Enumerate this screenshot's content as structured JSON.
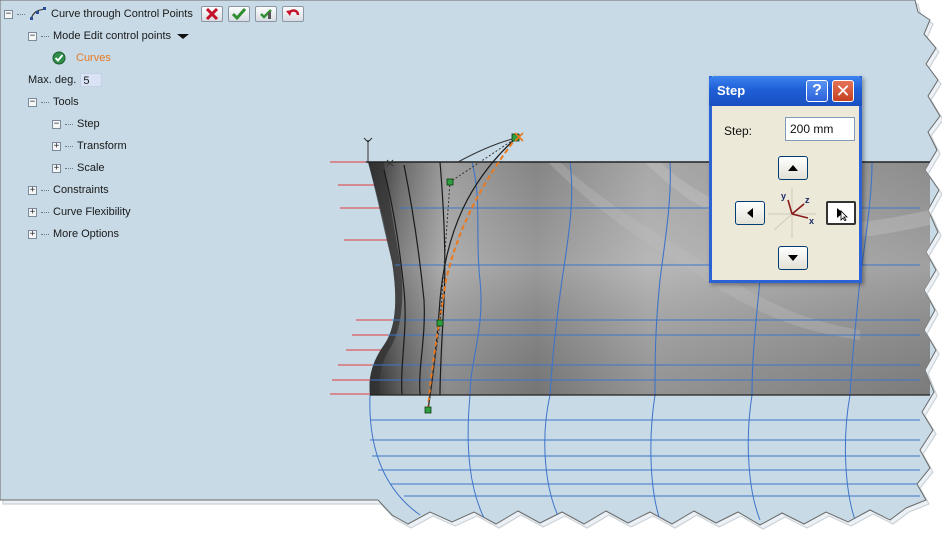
{
  "panel": {
    "title": "Curve through Control Points",
    "mode_label": "Mode Edit control points",
    "curves_label": "Curves",
    "max_deg_label": "Max. deg.",
    "max_deg_value": "5",
    "tools_label": "Tools",
    "step_label": "Step",
    "transform_label": "Transform",
    "scale_label": "Scale",
    "constraints_label": "Constraints",
    "flexibility_label": "Curve Flexibility",
    "more_options_label": "More Options",
    "toolbar_icons": [
      "cancel-icon",
      "ok-icon",
      "apply-icon",
      "undo-icon"
    ]
  },
  "dialog": {
    "title": "Step",
    "help_glyph": "?",
    "close_glyph": "✕",
    "step_label": "Step:",
    "step_value": "200 mm",
    "axis_labels": {
      "x": "x",
      "y": "y",
      "z": "z"
    }
  },
  "colors": {
    "viewport_bg": "#c7dae6",
    "section_line_red": "#e23a3a",
    "grid_line_blue": "#3f74c8",
    "edit_curve": "#ea7a20",
    "control_point": "#2e9e3e",
    "dialog_titlebar": "#2b63d6",
    "curves_text": "#e87a22"
  }
}
